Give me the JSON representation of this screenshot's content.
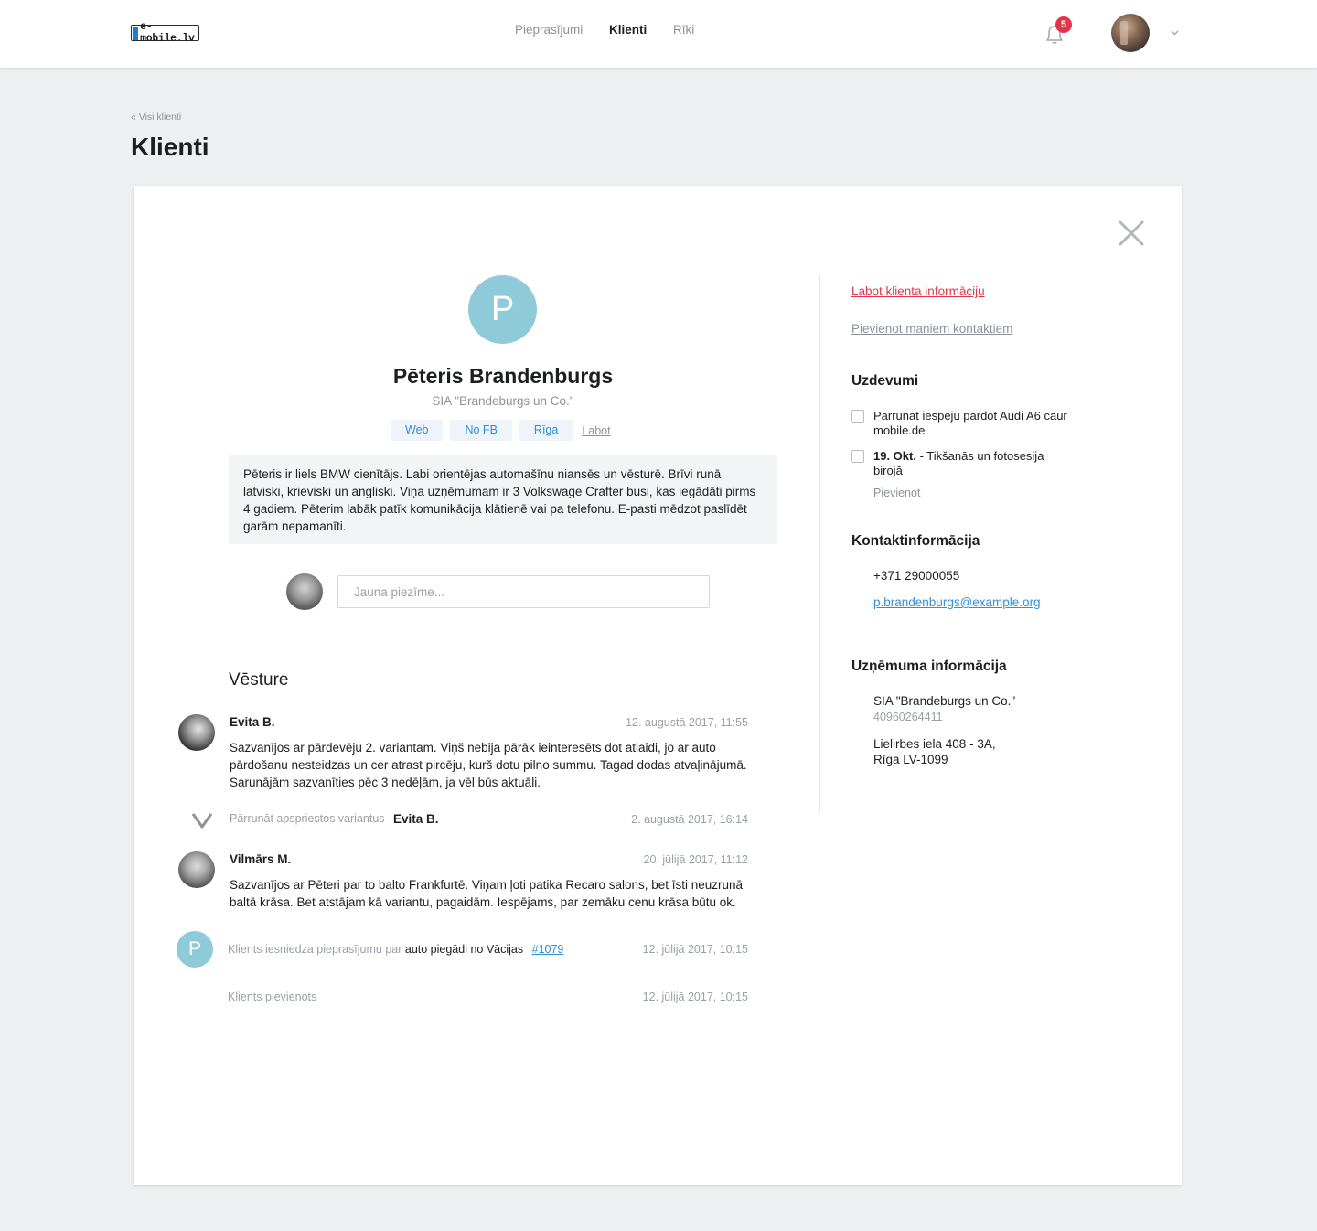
{
  "header": {
    "logo_text": "e-mobile.lv",
    "nav": [
      "Pieprasījumi",
      "Klienti",
      "Rīki"
    ],
    "active_nav": "Klienti",
    "notifications_count": "5"
  },
  "breadcrumb": "« Visi klienti",
  "page_title": "Klienti",
  "client": {
    "initial": "P",
    "name": "Pēteris Brandenburgs",
    "company": "SIA \"Brandeburgs un Co.\"",
    "tags": [
      "Web",
      "No FB",
      "Rīga"
    ],
    "tags_edit": "Labot",
    "description": "Pēteris ir liels BMW cienītājs. Labi orientējas automašīnu niansēs un vēsturē. Brīvi runā latviski, krieviski un angliski. Viņa uzņēmumam ir 3 Volkswage Crafter busi, kas iegādāti pirms 4 gadiem. Pēterim labāk patīk komunikācija klātienē vai pa telefonu. E-pasti mēdzot paslīdēt garām nepamanīti."
  },
  "new_note": {
    "placeholder": "Jauna piezīme..."
  },
  "history": {
    "title": "Vēsture",
    "entry1": {
      "author": "Evita B.",
      "date": "12. augustā 2017, 11:55",
      "text": "Sazvanījos ar pārdevēju 2. variantam. Viņš nebija pārāk ieinteresēts dot atlaidi, jo ar auto pārdošanu nesteidzas un cer atrast pircēju, kurš dotu pilno summu. Tagad dodas atvaļinājumā. Sarunājām sazvanīties pēc 3 nedēļām, ja vēl būs aktuāli."
    },
    "entry2": {
      "task": "Pārrunāt apspriestos variantus",
      "author": "Evita B.",
      "date": "2. augustā 2017, 16:14"
    },
    "entry3": {
      "author": "Vilmārs M.",
      "date": "20. jūlijā 2017, 11:12",
      "text": "Sazvanījos ar Pēteri par to balto Frankfurtē. Viņam ļoti patika Recaro salons, bet īsti neuzrunā baltā krāsa. Bet atstājam kā variantu, pagaidām. Iespējams, par zemāku cenu krāsa būtu ok."
    },
    "entry4": {
      "initial": "P",
      "prefix": "Klients iesniedza pieprasījumu par",
      "subject": "auto piegādi no Vācijas",
      "link": "#1079",
      "date": "12. jūlijā 2017, 10:15"
    },
    "entry5": {
      "text": "Klients pievienots",
      "date": "12. jūlijā 2017, 10:15"
    }
  },
  "sidebar": {
    "edit_link": "Labot klienta informāciju",
    "add_contacts_link": "Pievienot maniem kontaktiem",
    "tasks_title": "Uzdevumi",
    "tasks": [
      {
        "bold": "",
        "text": "Pārrunāt iespēju pārdot Audi A6 caur mobile.de"
      },
      {
        "bold": "19. Okt.",
        "text": " - Tikšanās un fotosesija birojā"
      }
    ],
    "tasks_add": "Pievienot",
    "contact_title": "Kontaktinformācija",
    "phone": "+371 29000055",
    "email": "p.brandenburgs@example.org",
    "company_title": "Uzņēmuma informācija",
    "company_name": "SIA \"Brandeburgs un Co.\"",
    "company_reg": "40960264411",
    "address_line1": "Lielirbes iela 408 - 3A,",
    "address_line2": "Rīga LV-1099"
  },
  "colors": {
    "accent_blue": "#2f8fd8",
    "accent_red": "#e2344b",
    "avatar_teal": "#8fcad9",
    "page_bg": "#eeeff1"
  },
  "icons": [
    "bell-icon",
    "chevron-down-icon",
    "close-icon",
    "checkmark-icon"
  ]
}
